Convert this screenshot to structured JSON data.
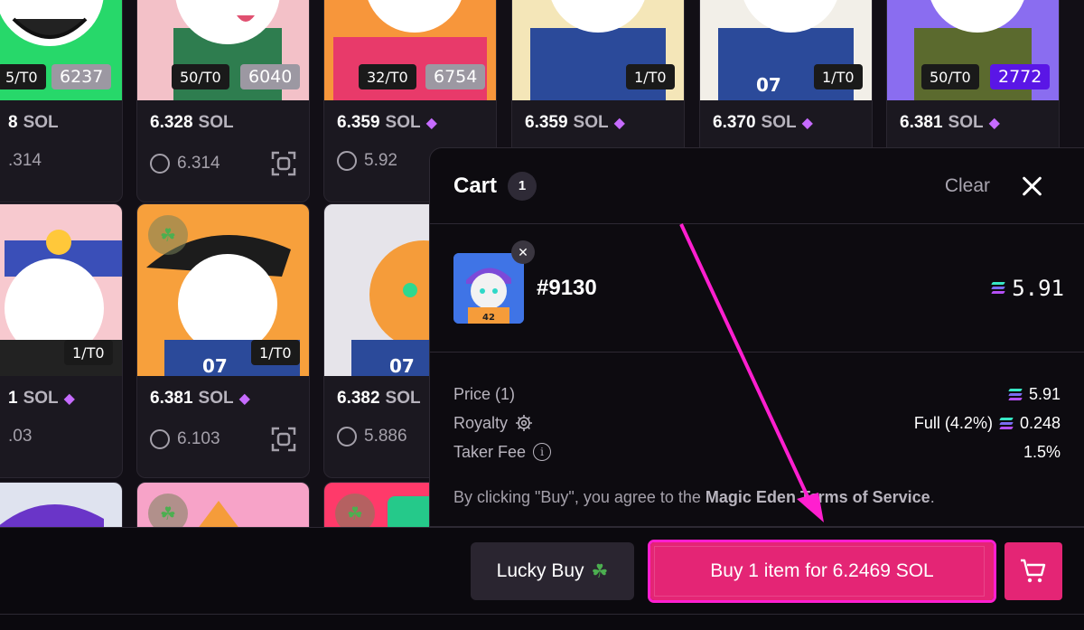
{
  "colors": {
    "accent_pink": "#e42575",
    "annotation_magenta": "#ff1fcf",
    "gem_purple": "#c66bff"
  },
  "grid": {
    "cards": [
      {
        "rank_supply": "5/T0",
        "rank": "6237",
        "price": "8",
        "currency": "SOL",
        "gem": false,
        "last": ".314",
        "bg": "#27d86a"
      },
      {
        "rank_supply": "50/T0",
        "rank": "6040",
        "price": "6.328",
        "currency": "SOL",
        "gem": false,
        "last": "6.314",
        "bg": "#f3c1c8"
      },
      {
        "rank_supply": "32/T0",
        "rank": "6754",
        "price": "6.359",
        "currency": "SOL",
        "gem": true,
        "last": "5.92",
        "bg": "#f7963b"
      },
      {
        "rank_supply": "1/T0",
        "rank": "",
        "price": "6.359",
        "currency": "SOL",
        "gem": true,
        "last": "",
        "bg": "#f4e6b8"
      },
      {
        "rank_supply": "1/T0",
        "rank": "",
        "price": "6.370",
        "currency": "SOL",
        "gem": true,
        "last": "",
        "bg": "#f2efe8"
      },
      {
        "rank_supply": "50/T0",
        "rank": "2772",
        "price": "6.381",
        "currency": "SOL",
        "gem": true,
        "last": "",
        "bg": "#8a6df0"
      },
      {
        "rank_supply": "1/T0",
        "rank": "",
        "price": "1",
        "currency": "SOL",
        "gem": true,
        "last": ".03",
        "bg": "#f7c9cf"
      },
      {
        "rank_supply": "1/T0",
        "rank": "",
        "price": "6.381",
        "currency": "SOL",
        "gem": true,
        "last": "6.103",
        "bg": "#f7a03c"
      },
      {
        "rank_supply": "",
        "rank": "",
        "price": "6.382",
        "currency": "SOL",
        "gem": false,
        "last": "5.886",
        "bg": "#e6e4ea"
      }
    ],
    "clover_icon": "☘"
  },
  "cart": {
    "title": "Cart",
    "count": "1",
    "clear_label": "Clear",
    "item": {
      "name": "#9130",
      "price": "5.91",
      "thumb_number": "42"
    },
    "fees": {
      "price_label": "Price (1)",
      "price_value": "5.91",
      "royalty_label": "Royalty",
      "royalty_mode": "Full (4.2%)",
      "royalty_value": "0.248",
      "taker_label": "Taker Fee",
      "taker_value": "1.5%"
    },
    "terms_prefix": "By clicking \"Buy\", you agree to the ",
    "terms_link": "Magic Eden Terms of Service",
    "terms_suffix": "."
  },
  "bottom_bar": {
    "lucky_label": "Lucky Buy",
    "lucky_icon": "☘",
    "buy_label": "Buy 1 item for 6.2469 SOL"
  }
}
